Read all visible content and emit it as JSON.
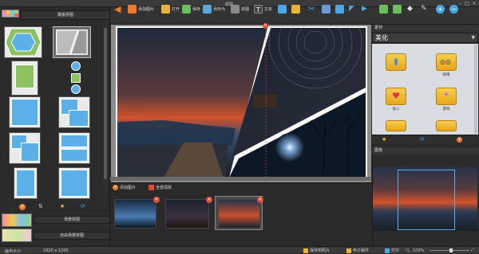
{
  "window": {
    "title": "拼图"
  },
  "left_panel": {
    "template_header": "模板拼图",
    "bottom_tabs": [
      "场景拼图",
      "自由场景拼图"
    ]
  },
  "toolbar": {
    "items": [
      {
        "label": "",
        "icon": "back-arrow-icon"
      },
      {
        "label": "添加图片",
        "icon": "add-image-icon"
      },
      {
        "label": "打开",
        "icon": "open-folder-icon"
      },
      {
        "label": "保存",
        "icon": "save-icon"
      },
      {
        "label": "另存为",
        "icon": "save-as-icon"
      },
      {
        "label": "拼图",
        "icon": "collage-icon"
      },
      {
        "label": "文本",
        "icon": "text-icon"
      }
    ]
  },
  "strip": {
    "add_label": "添加图片",
    "clear_label": "全部清除"
  },
  "right_panel": {
    "material_header": "素材",
    "category_value": "美化",
    "materials": [
      {
        "label": ""
      },
      {
        "label": "眼镜"
      },
      {
        "label": "爱心"
      },
      {
        "label": "游戏"
      }
    ],
    "preview_header": "图像"
  },
  "status": {
    "canvas_size_label": "画布大小",
    "canvas_size_value": "1920 x 1200",
    "save_label": "保存到照片",
    "email_label": "电子邮件",
    "print_label": "打印",
    "zoom": "100%"
  },
  "colors": {
    "accent_blue": "#5cb0e8",
    "accent_green": "#8cc261",
    "folder_yellow": "#f0c030",
    "close_red": "#e24b33"
  }
}
